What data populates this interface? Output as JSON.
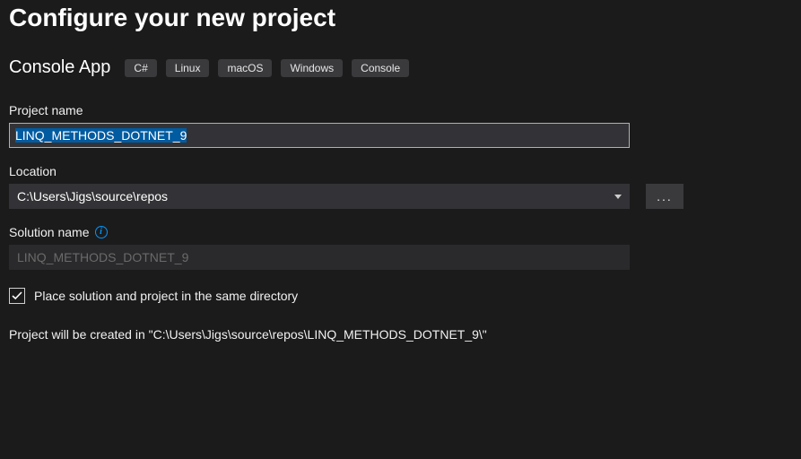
{
  "title": "Configure your new project",
  "template": {
    "name": "Console App",
    "tags": [
      "C#",
      "Linux",
      "macOS",
      "Windows",
      "Console"
    ]
  },
  "projectName": {
    "label": "Project name",
    "value": "LINQ_METHODS_DOTNET_9"
  },
  "location": {
    "label": "Location",
    "value": "C:\\Users\\Jigs\\source\\repos",
    "browse": "..."
  },
  "solutionName": {
    "label": "Solution name",
    "value": "LINQ_METHODS_DOTNET_9"
  },
  "sameDir": {
    "checked": true,
    "label": "Place solution and project in the same directory"
  },
  "summary": "Project will be created in \"C:\\Users\\Jigs\\source\\repos\\LINQ_METHODS_DOTNET_9\\\""
}
